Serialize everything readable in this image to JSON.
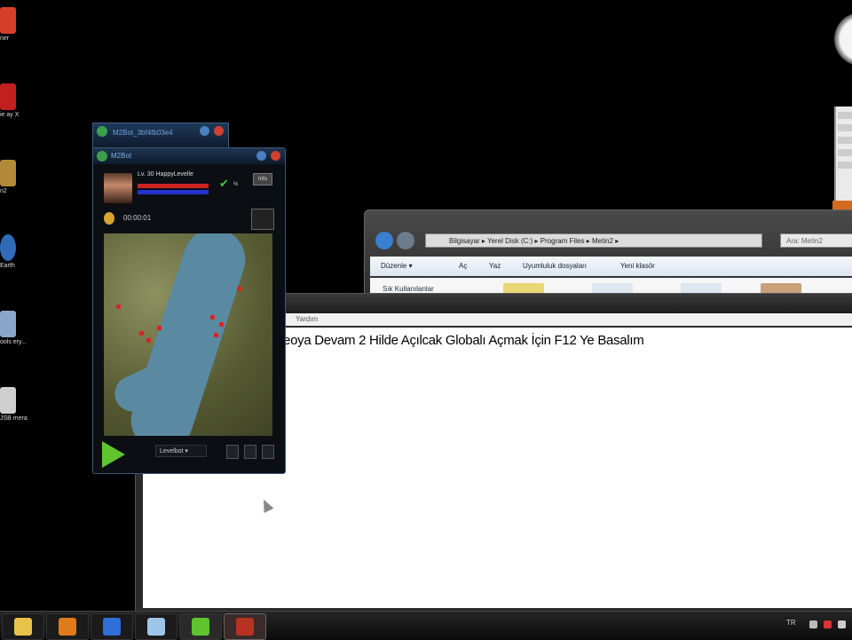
{
  "desktop": {
    "icons": [
      {
        "label": "ner",
        "color": "#d6402b"
      },
      {
        "label": "ie\nay X",
        "color": "#c21f1f"
      },
      {
        "label": "n2",
        "color": "#b48a3a"
      },
      {
        "label": "Earth",
        "color": "#2f6bb8"
      },
      {
        "label": "ools\nery...",
        "color": "#8aa6c8"
      },
      {
        "label": "JSB\nmera",
        "color": "#cfcfcf"
      }
    ]
  },
  "explorer": {
    "address": "Bilgisayar ▸ Yerel Disk (C:) ▸ Program Files ▸ Metin2 ▸",
    "search_placeholder": "Ara: Metin2",
    "toolbar": {
      "organize": "Düzenle ▾",
      "open": "Aç",
      "burn": "Yaz",
      "compat": "Uyumluluk dosyaları",
      "new_folder": "Yeni klasör"
    },
    "favorites": "Sık Kullanılanlar"
  },
  "notepad": {
    "menu_help": "Yardım",
    "text": "deoya Devam 2 Hilde Açılcak Globalı Açmak İçin F12 Ye Basalım"
  },
  "bot_back": {
    "title": "M2Bot_3bf4fb03e4"
  },
  "bot": {
    "title": "M2Bot",
    "character": "Lv. 30  HappyLevelle",
    "hp_pct_label": "%",
    "info_label": "Info",
    "timer": "00:00:01",
    "mode": "Levelbot  ▾"
  },
  "taskbar": {
    "items": [
      {
        "name": "explorer",
        "color": "#e8c24a"
      },
      {
        "name": "media-player",
        "color": "#e07b1a"
      },
      {
        "name": "bot-app",
        "color": "#2f6fd8"
      },
      {
        "name": "notepad",
        "color": "#9fc6e8"
      },
      {
        "name": "m2bot",
        "color": "#5ec52e"
      },
      {
        "name": "metin2",
        "color": "#b83222"
      }
    ],
    "lang": "TR"
  }
}
